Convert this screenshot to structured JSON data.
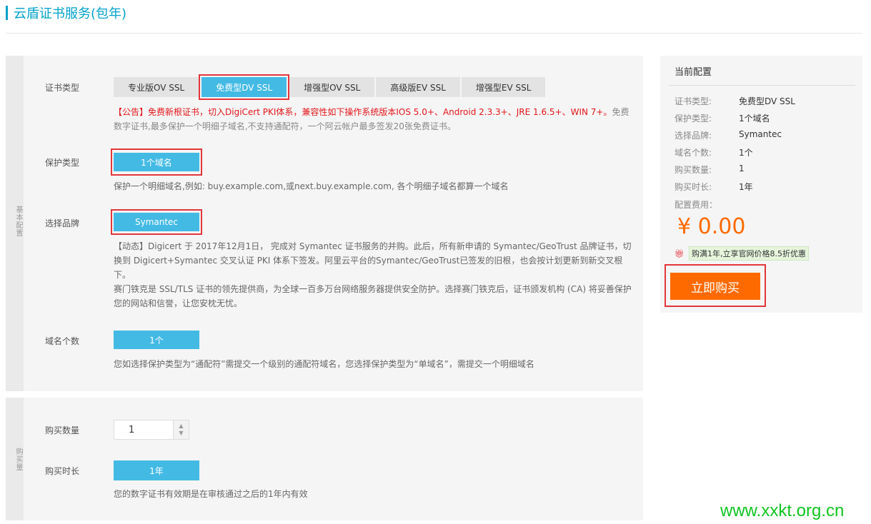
{
  "header": {
    "title": "云盾证书服务(包年)"
  },
  "basic": {
    "side_label": "基本配置",
    "cert_type": {
      "label": "证书类型",
      "tabs": [
        "专业版OV SSL",
        "免费型DV SSL",
        "增强型OV SSL",
        "高级版EV SSL",
        "增强型EV SSL"
      ],
      "active_index": 1,
      "notice_red": "【公告】免费新根证书，切入DigiCert PKI体系，兼容性如下操作系统版本IOS 5.0+、Android 2.3.3+、JRE 1.6.5+、WIN 7+。",
      "notice_gray": "免费数字证书,最多保护一个明细子域名,不支持通配符，一个阿云帐户最多签发20张免费证书。"
    },
    "protect": {
      "label": "保护类型",
      "button": "1个域名",
      "desc": "保护一个明细域名,例如: buy.example.com,或next.buy.example.com, 各个明细子域名都算一个域名"
    },
    "brand": {
      "label": "选择品牌",
      "button": "Symantec",
      "desc1": "【动态】Digicert 于 2017年12月1日， 完成对 Symantec 证书服务的并购。此后，所有新申请的 Symantec/GeoTrust 品牌证书，切换到 Digicert+Symantec 交叉认证 PKI 体系下签发。阿里云平台的Symantec/GeoTrust已签发的旧根，也会按计划更新到新交叉根下。",
      "desc2": "赛门铁克是 SSL/TLS 证书的领先提供商，为全球一百多万台网络服务器提供安全防护。选择赛门铁克后，证书颁发机构 (CA) 将妥善保护您的网站和信誉，让您安枕无忧。"
    },
    "domain_count": {
      "label": "域名个数",
      "button": "1个",
      "desc": "您如选择保护类型为“通配符”需提交一个级别的通配符域名，您选择保护类型为“单域名”，需提交一个明细域名"
    }
  },
  "purchase": {
    "side_label": "购买量",
    "quantity": {
      "label": "购买数量",
      "value": "1"
    },
    "duration": {
      "label": "购买时长",
      "button": "1年",
      "desc": "您的数字证书有效期是在审核通过之后的1年内有效"
    }
  },
  "summary": {
    "title": "当前配置",
    "rows": [
      {
        "k": "证书类型:",
        "v": "免费型DV SSL"
      },
      {
        "k": "保护类型:",
        "v": "1个域名"
      },
      {
        "k": "选择品牌:",
        "v": "Symantec"
      },
      {
        "k": "域名个数:",
        "v": "1个"
      },
      {
        "k": "购买数量:",
        "v": "1"
      },
      {
        "k": "购买时长:",
        "v": "1年"
      }
    ],
    "fee_label": "配置费用：",
    "price": "¥ 0.00",
    "promo": "购满1年,立享官网价格8.5折优惠",
    "buy_label": "立即购买"
  },
  "watermark": "www.xxkt.org.cn",
  "colors": {
    "accent": "#43bae4",
    "buy": "#ff6a00",
    "highlight": "#e3363b",
    "title": "#00a2ca"
  }
}
